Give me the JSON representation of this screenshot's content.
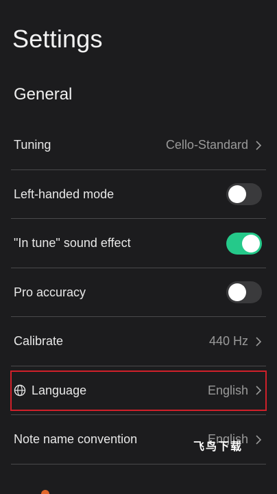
{
  "header": {
    "title": "Settings"
  },
  "section": {
    "title": "General"
  },
  "rows": {
    "tuning": {
      "label": "Tuning",
      "value": "Cello-Standard"
    },
    "left_handed": {
      "label": "Left-handed mode",
      "enabled": false
    },
    "in_tune": {
      "label": "\"In tune\" sound effect",
      "enabled": true
    },
    "pro_accuracy": {
      "label": "Pro accuracy",
      "enabled": false
    },
    "calibrate": {
      "label": "Calibrate",
      "value": "440 Hz"
    },
    "language": {
      "label": "Language",
      "value": "English"
    },
    "note_name": {
      "label": "Note name convention",
      "value": "English"
    }
  },
  "watermark": {
    "text": "飞鸟下载"
  },
  "colors": {
    "background": "#1c1c1e",
    "toggle_on": "#25c98a",
    "toggle_off": "#3a3a3c",
    "highlight_border": "#d0202a"
  }
}
